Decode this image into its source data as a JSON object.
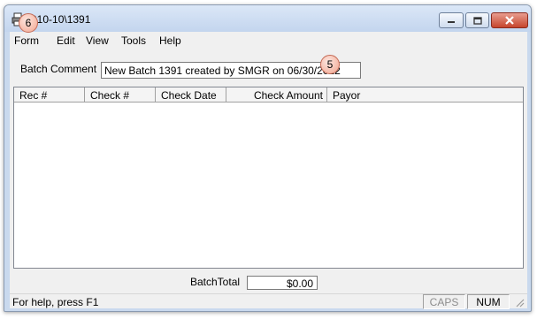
{
  "window": {
    "title": "010-10\\1391"
  },
  "menu": {
    "items": [
      "Form",
      "Edit",
      "View",
      "Tools",
      "Help"
    ]
  },
  "batch": {
    "label": "Batch Comment",
    "comment": "New Batch 1391 created by SMGR on 06/30/2012"
  },
  "grid": {
    "columns": [
      "Rec #",
      "Check #",
      "Check Date",
      "Check Amount",
      "Payor"
    ],
    "rows": []
  },
  "totals": {
    "label": "BatchTotal",
    "value": "$0.00"
  },
  "status": {
    "help_text": "For help, press F1",
    "caps": "CAPS",
    "num": "NUM"
  },
  "annotations": {
    "badge_form": "6",
    "badge_comment": "5"
  },
  "icons": {
    "app": "printer-icon",
    "minimize": "minimize-icon",
    "maximize": "maximize-icon",
    "close": "close-icon",
    "grip": "resize-grip-icon"
  }
}
